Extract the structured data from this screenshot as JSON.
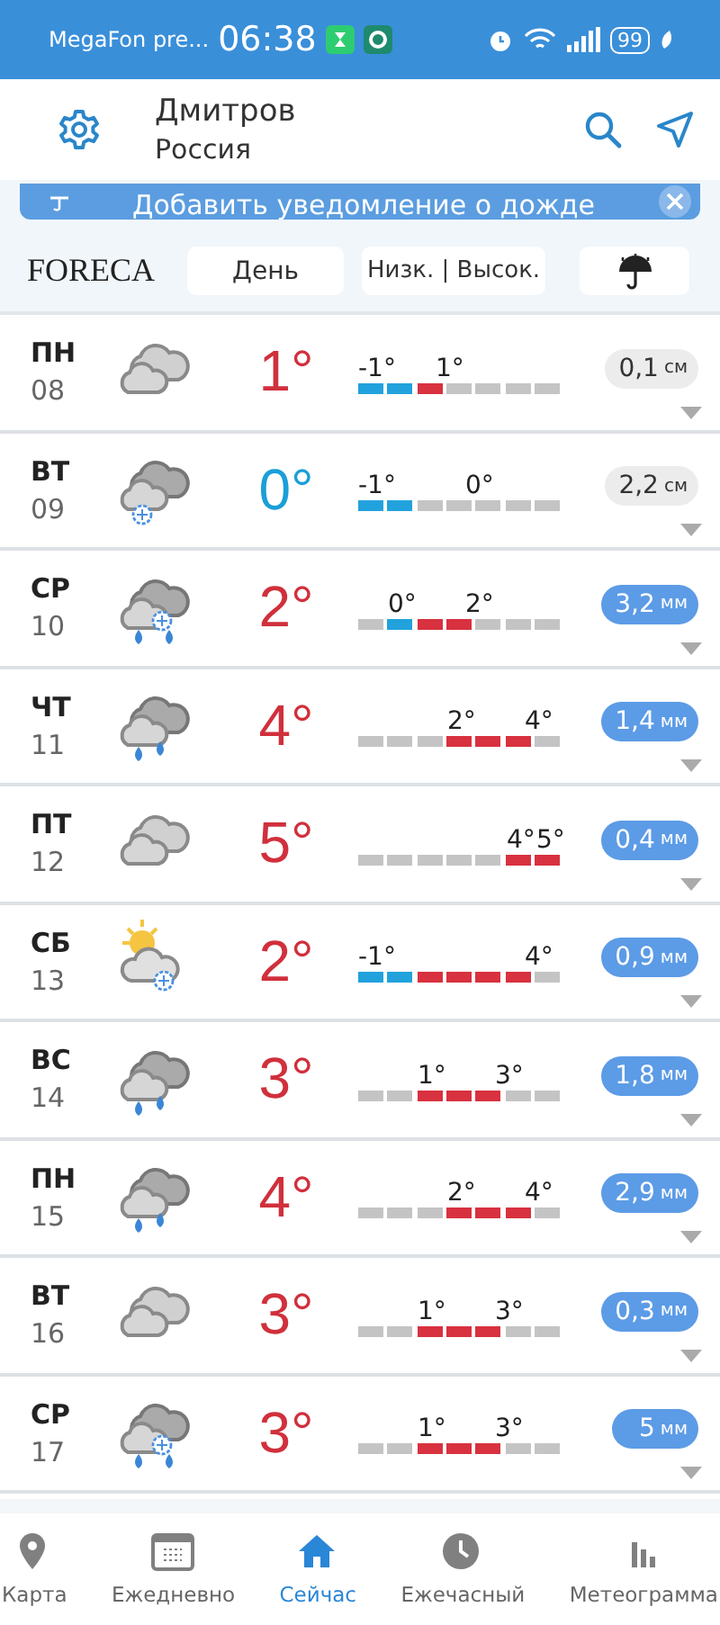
{
  "status_bar": {
    "carrier": "MegaFon pre...",
    "time": "06:38",
    "battery": "99"
  },
  "header": {
    "city": "Дмитров",
    "country": "Россия"
  },
  "banner": {
    "text": "Добавить уведомление о дожде"
  },
  "toolbar": {
    "logo": "FORECA",
    "buttons": [
      {
        "label": "День"
      },
      {
        "label": "Низк. | Высок."
      }
    ]
  },
  "days": [
    {
      "day": "ПН",
      "date": "08",
      "kind": "cloudy",
      "temp": "1°",
      "color": "#d0303c",
      "low": "-1°",
      "high": "1°",
      "segments": [
        {
          "color": "#22a2dd"
        },
        {
          "color": "#22a2dd"
        },
        {
          "color": "#d8313f"
        },
        {
          "color": "#c4c4c4"
        },
        {
          "color": "#c4c4c4"
        },
        {
          "color": "#c4c4c4"
        },
        {
          "color": "#c4c4c4"
        }
      ],
      "precipitation": {
        "amount": "0,1",
        "unit": "см",
        "color": "#ececec"
      }
    },
    {
      "day": "ВТ",
      "date": "09",
      "kind": "snow",
      "temp": "0°",
      "color": "#1a9fd8",
      "low": "-1°",
      "high": "0°",
      "segments": [
        {
          "color": "#22a2dd"
        },
        {
          "color": "#22a2dd"
        },
        {
          "color": "#c4c4c4"
        },
        {
          "color": "#c4c4c4"
        },
        {
          "color": "#c4c4c4"
        },
        {
          "color": "#c4c4c4"
        },
        {
          "color": "#c4c4c4"
        }
      ],
      "precipitation": {
        "amount": "2,2",
        "unit": "см",
        "color": "#ececec"
      }
    },
    {
      "day": "СР",
      "date": "10",
      "kind": "sleet",
      "temp": "2°",
      "color": "#d0303c",
      "low": "0°",
      "high": "2°",
      "segments": [
        {
          "color": "#c4c4c4"
        },
        {
          "color": "#22a2dd"
        },
        {
          "color": "#d8313f"
        },
        {
          "color": "#d8313f"
        },
        {
          "color": "#c4c4c4"
        },
        {
          "color": "#c4c4c4"
        },
        {
          "color": "#c4c4c4"
        }
      ],
      "precipitation": {
        "amount": "3,2",
        "unit": "мм",
        "color": "#5c9be6"
      }
    },
    {
      "day": "ЧТ",
      "date": "11",
      "kind": "rain",
      "temp": "4°",
      "color": "#d0303c",
      "low": "2°",
      "high": "4°",
      "segments": [
        {
          "color": "#c4c4c4"
        },
        {
          "color": "#c4c4c4"
        },
        {
          "color": "#c4c4c4"
        },
        {
          "color": "#d8313f"
        },
        {
          "color": "#d8313f"
        },
        {
          "color": "#d8313f"
        },
        {
          "color": "#c4c4c4"
        }
      ],
      "precipitation": {
        "amount": "1,4",
        "unit": "мм",
        "color": "#5c9be6"
      }
    },
    {
      "day": "ПТ",
      "date": "12",
      "kind": "cloudy",
      "temp": "5°",
      "color": "#d0303c",
      "low": "4°",
      "high": "5°",
      "segments": [
        {
          "color": "#c4c4c4"
        },
        {
          "color": "#c4c4c4"
        },
        {
          "color": "#c4c4c4"
        },
        {
          "color": "#c4c4c4"
        },
        {
          "color": "#c4c4c4"
        },
        {
          "color": "#d8313f"
        },
        {
          "color": "#d8313f"
        }
      ],
      "precipitation": {
        "amount": "0,4",
        "unit": "мм",
        "color": "#5c9be6"
      }
    },
    {
      "day": "СБ",
      "date": "13",
      "kind": "sun-snow",
      "temp": "2°",
      "color": "#d0303c",
      "low": "-1°",
      "high": "4°",
      "segments": [
        {
          "color": "#22a2dd"
        },
        {
          "color": "#22a2dd"
        },
        {
          "color": "#d8313f"
        },
        {
          "color": "#d8313f"
        },
        {
          "color": "#d8313f"
        },
        {
          "color": "#d8313f"
        },
        {
          "color": "#c4c4c4"
        }
      ],
      "precipitation": {
        "amount": "0,9",
        "unit": "мм",
        "color": "#5c9be6"
      }
    },
    {
      "day": "ВС",
      "date": "14",
      "kind": "rain",
      "temp": "3°",
      "color": "#d0303c",
      "low": "1°",
      "high": "3°",
      "segments": [
        {
          "color": "#c4c4c4"
        },
        {
          "color": "#c4c4c4"
        },
        {
          "color": "#d8313f"
        },
        {
          "color": "#d8313f"
        },
        {
          "color": "#d8313f"
        },
        {
          "color": "#c4c4c4"
        },
        {
          "color": "#c4c4c4"
        }
      ],
      "precipitation": {
        "amount": "1,8",
        "unit": "мм",
        "color": "#5c9be6"
      }
    },
    {
      "day": "ПН",
      "date": "15",
      "kind": "rain",
      "temp": "4°",
      "color": "#d0303c",
      "low": "2°",
      "high": "4°",
      "segments": [
        {
          "color": "#c4c4c4"
        },
        {
          "color": "#c4c4c4"
        },
        {
          "color": "#c4c4c4"
        },
        {
          "color": "#d8313f"
        },
        {
          "color": "#d8313f"
        },
        {
          "color": "#d8313f"
        },
        {
          "color": "#c4c4c4"
        }
      ],
      "precipitation": {
        "amount": "2,9",
        "unit": "мм",
        "color": "#5c9be6"
      }
    },
    {
      "day": "ВТ",
      "date": "16",
      "kind": "cloudy",
      "temp": "3°",
      "color": "#d0303c",
      "low": "1°",
      "high": "3°",
      "segments": [
        {
          "color": "#c4c4c4"
        },
        {
          "color": "#c4c4c4"
        },
        {
          "color": "#d8313f"
        },
        {
          "color": "#d8313f"
        },
        {
          "color": "#d8313f"
        },
        {
          "color": "#c4c4c4"
        },
        {
          "color": "#c4c4c4"
        }
      ],
      "precipitation": {
        "amount": "0,3",
        "unit": "мм",
        "color": "#5c9be6"
      }
    },
    {
      "day": "СР",
      "date": "17",
      "kind": "sleet",
      "temp": "3°",
      "color": "#d0303c",
      "low": "1°",
      "high": "3°",
      "segments": [
        {
          "color": "#c4c4c4"
        },
        {
          "color": "#c4c4c4"
        },
        {
          "color": "#d8313f"
        },
        {
          "color": "#d8313f"
        },
        {
          "color": "#d8313f"
        },
        {
          "color": "#c4c4c4"
        },
        {
          "color": "#c4c4c4"
        }
      ],
      "precipitation": {
        "amount": "5",
        "unit": "мм",
        "color": "#5c9be6"
      }
    }
  ],
  "nav": [
    {
      "label": "Карта",
      "kind": "pin",
      "selected": false
    },
    {
      "label": "Ежедневно",
      "kind": "calendar",
      "selected": false
    },
    {
      "label": "Сейчас",
      "kind": "home",
      "selected": true
    },
    {
      "label": "Ежечасный",
      "kind": "clock",
      "selected": false
    },
    {
      "label": "Метеограмма",
      "kind": "bars",
      "selected": false
    }
  ]
}
